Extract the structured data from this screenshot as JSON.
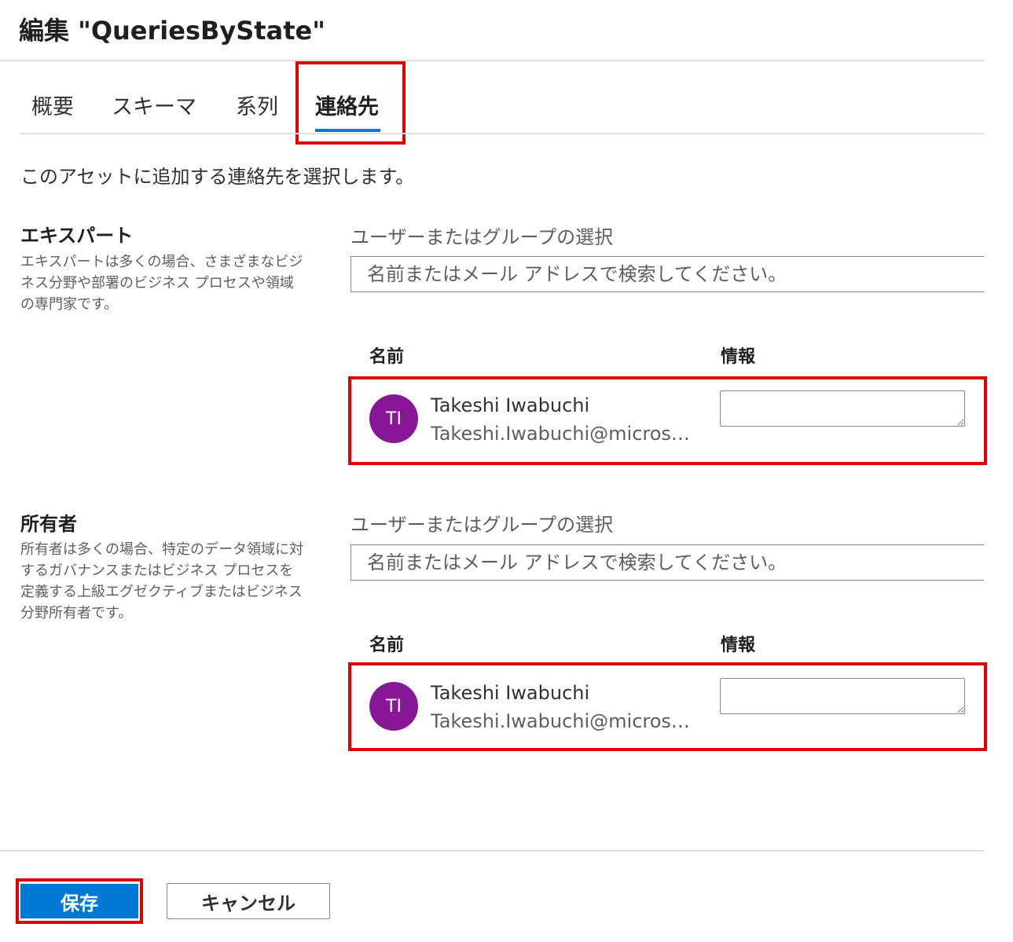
{
  "header": {
    "title": "編集 \"QueriesByState\""
  },
  "tabs": [
    {
      "label": "概要"
    },
    {
      "label": "スキーマ"
    },
    {
      "label": "系列"
    },
    {
      "label": "連絡先",
      "active": true
    }
  ],
  "intro": "このアセットに追加する連絡先を選択します。",
  "sections": {
    "experts": {
      "title": "エキスパート",
      "description": "エキスパートは多くの場合、さまざまなビジネス分野や部署のビジネス プロセスや領域の専門家です。",
      "select_label": "ユーザーまたはグループの選択",
      "search_placeholder": "名前またはメール アドレスで検索してください。",
      "col_name": "名前",
      "col_info": "情報",
      "person": {
        "initials": "TI",
        "name": "Takeshi Iwabuchi",
        "email": "Takeshi.Iwabuchi@microsof..."
      }
    },
    "owners": {
      "title": "所有者",
      "description": "所有者は多くの場合、特定のデータ領域に対するガバナンスまたはビジネス プロセスを定義する上級エグゼクティブまたはビジネス分野所有者です。",
      "select_label": "ユーザーまたはグループの選択",
      "search_placeholder": "名前またはメール アドレスで検索してください。",
      "col_name": "名前",
      "col_info": "情報",
      "person": {
        "initials": "TI",
        "name": "Takeshi Iwabuchi",
        "email": "Takeshi.Iwabuchi@microsof..."
      }
    }
  },
  "footer": {
    "save_label": "保存",
    "cancel_label": "キャンセル"
  },
  "colors": {
    "accent": "#0078d4",
    "avatar": "#881798",
    "highlight": "#e00000"
  }
}
